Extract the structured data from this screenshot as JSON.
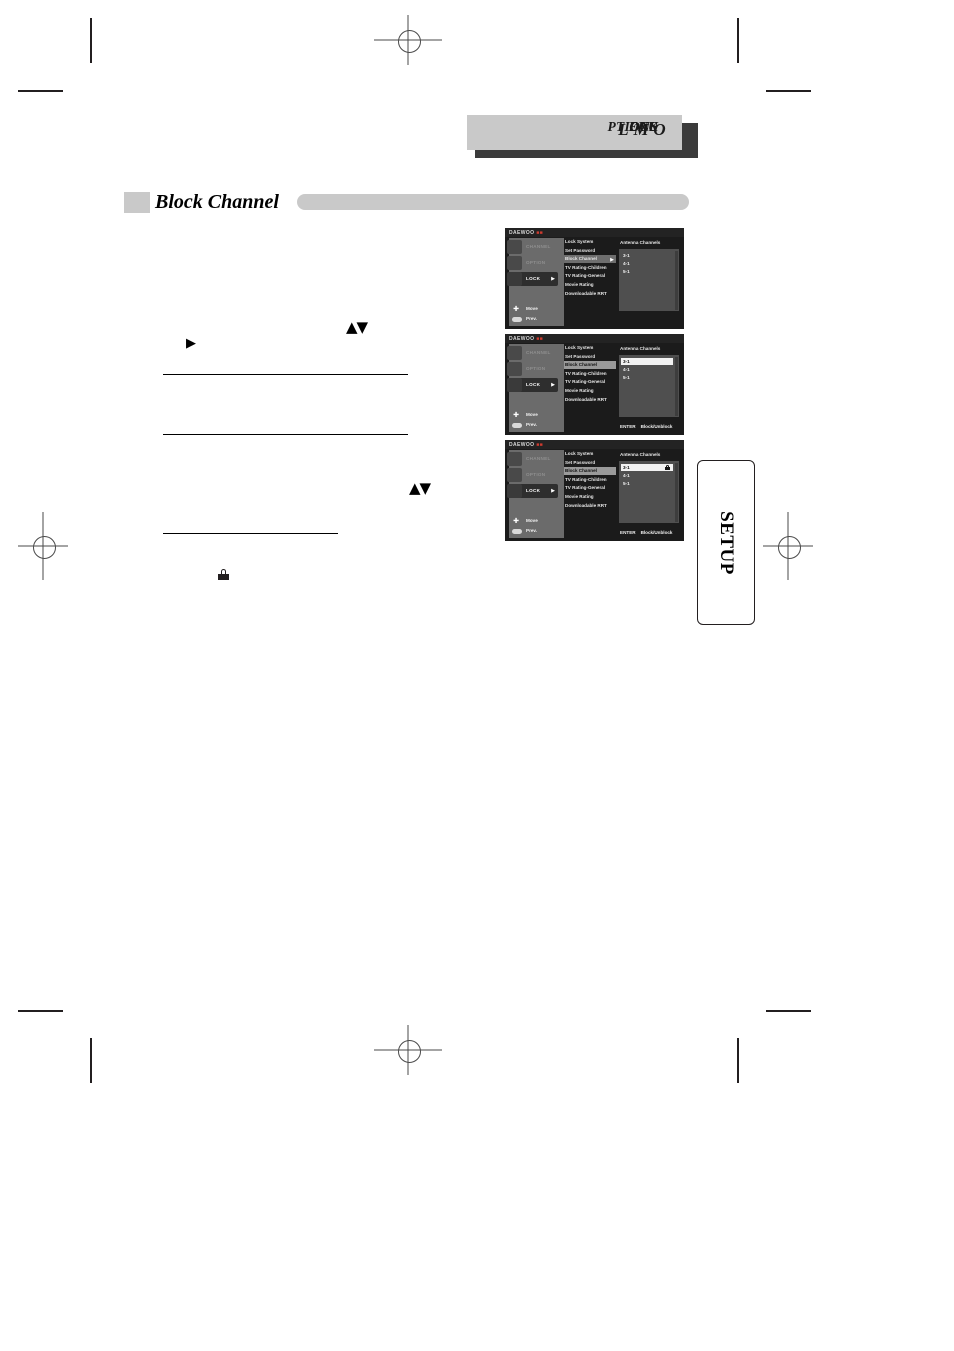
{
  "page": {
    "running_head": "Lock Menu Options",
    "section_title": "Block Channel",
    "side_tab": "SETUP"
  },
  "osd_common": {
    "brand": "DAEWOO",
    "nav": [
      {
        "label": "CHANNEL",
        "icon": "tv-icon",
        "active": false
      },
      {
        "label": "OPTION",
        "icon": "gear-icon",
        "active": false
      },
      {
        "label": "LOCK",
        "icon": "lock-icon",
        "active": true,
        "arrow": "▶"
      }
    ],
    "menu_items": [
      "Lock System",
      "Set Password",
      "Block Channel",
      "TV Rating-Children",
      "TV Rating-General",
      "Movie Rating",
      "Downloadable RRT"
    ],
    "selected_menu_item": "Block Channel",
    "menu_item_arrow": "▶",
    "panel_title": "Antenna Channels",
    "channels": [
      "3-1",
      "4-1",
      "5-1"
    ],
    "footer": {
      "move_label": "Move",
      "move_icon": "dpad-icon",
      "prev_label": "Prev.",
      "prev_icon": "prev-button-icon"
    },
    "enter_hint_key": "ENTER",
    "enter_hint_action": "Block/Unblock"
  },
  "osd_screens": [
    {
      "id": "screen-1",
      "selected_channel_index": null,
      "show_enter_hint": false,
      "locked_channels": [],
      "menu_arrow_visible": true
    },
    {
      "id": "screen-2",
      "selected_channel_index": 0,
      "show_enter_hint": true,
      "locked_channels": [],
      "menu_arrow_visible": false
    },
    {
      "id": "screen-3",
      "selected_channel_index": 0,
      "show_enter_hint": true,
      "locked_channels": [
        0
      ],
      "menu_arrow_visible": false
    }
  ],
  "body_marks": {
    "arrow_right_glyph": "▶",
    "arrow_updown_glyph": "▲▼",
    "lock_glyph_name": "lock-icon"
  }
}
